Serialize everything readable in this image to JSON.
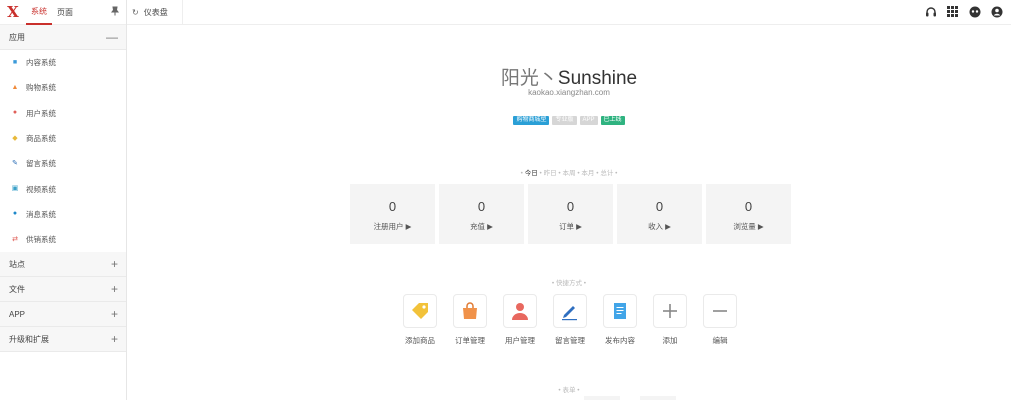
{
  "sidebar": {
    "logo": "X",
    "tabs": [
      {
        "label": "系统",
        "active": true
      },
      {
        "label": "页面",
        "active": false
      }
    ],
    "groups": [
      {
        "label": "应用",
        "toggle": "—",
        "expanded": true,
        "items": [
          {
            "label": "内容系统",
            "icon": "doc-icon",
            "glyph": "■",
            "color": "#3a9ad9"
          },
          {
            "label": "购物系统",
            "icon": "bag-icon",
            "glyph": "▲",
            "color": "#f08a3a"
          },
          {
            "label": "用户系统",
            "icon": "user-icon",
            "glyph": "●",
            "color": "#e0605a"
          },
          {
            "label": "商品系统",
            "icon": "tag-icon",
            "glyph": "◆",
            "color": "#e8b93a"
          },
          {
            "label": "留言系统",
            "icon": "pen-icon",
            "glyph": "✎",
            "color": "#2d6fb7"
          },
          {
            "label": "视频系统",
            "icon": "video-icon",
            "glyph": "▣",
            "color": "#3aa0c8"
          },
          {
            "label": "消息系统",
            "icon": "drop-icon",
            "glyph": "●",
            "color": "#1e88c9"
          },
          {
            "label": "供销系统",
            "icon": "exchange-icon",
            "glyph": "⇄",
            "color": "#e0605a"
          }
        ]
      },
      {
        "label": "站点",
        "toggle": "+"
      },
      {
        "label": "文件",
        "toggle": "+"
      },
      {
        "label": "APP",
        "toggle": "+"
      },
      {
        "label": "升级和扩展",
        "toggle": "+"
      }
    ]
  },
  "topbar": {
    "tab_label": "仪表盘",
    "tools": [
      {
        "icon": "headset-icon",
        "glyph": "🎧"
      },
      {
        "icon": "grid-icon",
        "glyph": "⊞"
      },
      {
        "icon": "robot-icon",
        "glyph": "☻"
      },
      {
        "icon": "account-icon",
        "glyph": "◉"
      }
    ]
  },
  "main": {
    "brand_cn": "阳光丶",
    "brand_en": "Sunshine",
    "domain": "kaokao.xiangzhan.com",
    "badges": [
      {
        "label": "购物商城型",
        "color": "#2a9fd6"
      },
      {
        "label": "专业版",
        "color": "#d6d6d6"
      },
      {
        "label": "APP",
        "color": "#d6d6d6"
      },
      {
        "label": "已上线",
        "color": "#2fb380"
      }
    ],
    "periods": [
      "今日",
      "昨日",
      "本周",
      "本月",
      "总计"
    ],
    "stats": [
      {
        "value": "0",
        "label": "注册用户 ▶"
      },
      {
        "value": "0",
        "label": "充值 ▶"
      },
      {
        "value": "0",
        "label": "订单 ▶"
      },
      {
        "value": "0",
        "label": "收入 ▶"
      },
      {
        "value": "0",
        "label": "浏览量 ▶"
      }
    ],
    "quick_title": "快捷方式",
    "quick": [
      {
        "label": "添加商品",
        "icon": "tag-icon"
      },
      {
        "label": "订单管理",
        "icon": "bag-icon"
      },
      {
        "label": "用户管理",
        "icon": "user-icon"
      },
      {
        "label": "留言管理",
        "icon": "pen-icon"
      },
      {
        "label": "发布内容",
        "icon": "doc-icon"
      },
      {
        "label": "添加",
        "icon": "plus-icon"
      },
      {
        "label": "编辑",
        "icon": "minus-icon"
      }
    ],
    "table_title": "表单"
  }
}
